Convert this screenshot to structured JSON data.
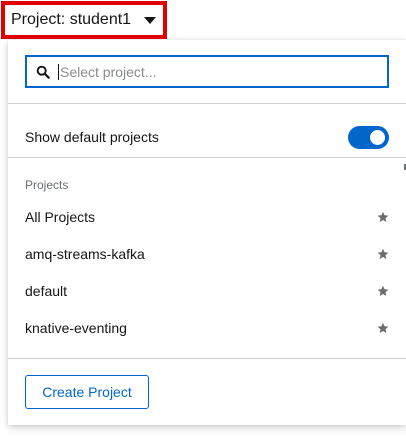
{
  "project_selector": {
    "label": "Project: student1"
  },
  "search": {
    "placeholder": "Select project...",
    "value": ""
  },
  "default_projects_toggle": {
    "label": "Show default projects",
    "checked": true
  },
  "projects_section": {
    "title": "Projects",
    "items": [
      {
        "name": "All Projects",
        "icon": "star-icon"
      },
      {
        "name": "amq-streams-kafka",
        "icon": "star-icon"
      },
      {
        "name": "default",
        "icon": "star-icon"
      },
      {
        "name": "knative-eventing",
        "icon": "star-icon"
      }
    ]
  },
  "footer": {
    "create_label": "Create Project"
  },
  "colors": {
    "accent": "#0066cc",
    "highlight_border": "#e00000",
    "muted_text": "#6a6e73",
    "star": "#6a6e73"
  }
}
